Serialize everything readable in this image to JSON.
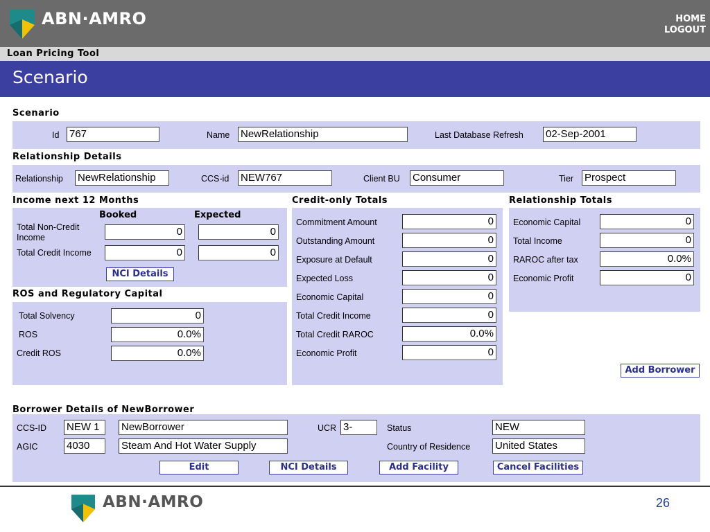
{
  "header": {
    "brand": "ABN·AMRO",
    "nav": {
      "home": "HOME",
      "logout": "LOGOUT"
    },
    "tool_name": "Loan Pricing Tool",
    "page_title": "Scenario"
  },
  "scenario": {
    "title": "Scenario",
    "id_label": "Id",
    "id_value": "767",
    "name_label": "Name",
    "name_value": "NewRelationship",
    "refresh_label": "Last Database Refresh",
    "refresh_value": "02-Sep-2001"
  },
  "relationship_details": {
    "title": "Relationship Details",
    "relationship_label": "Relationship",
    "relationship_value": "NewRelationship",
    "ccs_label": "CCS-id",
    "ccs_value": "NEW767",
    "bu_label": "Client BU",
    "bu_value": "Consumer",
    "tier_label": "Tier",
    "tier_value": "Prospect"
  },
  "income": {
    "title": "Income next 12 Months",
    "booked_header": "Booked",
    "expected_header": "Expected",
    "rows": [
      {
        "label": "Total Non-Credit Income",
        "booked": "0",
        "expected": "0"
      },
      {
        "label": "Total Credit Income",
        "booked": "0",
        "expected": "0"
      }
    ],
    "nci_button": "NCI Details"
  },
  "ros": {
    "title": "ROS and Regulatory Capital",
    "rows": [
      {
        "label": "Total Solvency",
        "value": "0"
      },
      {
        "label": "ROS",
        "value": "0.0%"
      },
      {
        "label": "Credit ROS",
        "value": "0.0%"
      }
    ]
  },
  "credit_totals": {
    "title": "Credit-only Totals",
    "rows": [
      {
        "label": "Commitment Amount",
        "value": "0"
      },
      {
        "label": "Outstanding Amount",
        "value": "0"
      },
      {
        "label": "Exposure at Default",
        "value": "0"
      },
      {
        "label": "Expected Loss",
        "value": "0"
      },
      {
        "label": "Economic Capital",
        "value": "0"
      },
      {
        "label": "Total Credit Income",
        "value": "0"
      },
      {
        "label": "Total Credit RAROC",
        "value": "0.0%"
      },
      {
        "label": "Economic Profit",
        "value": "0"
      }
    ]
  },
  "relationship_totals": {
    "title": "Relationship Totals",
    "rows": [
      {
        "label": "Economic Capital",
        "value": "0"
      },
      {
        "label": "Total Income",
        "value": "0"
      },
      {
        "label": "RAROC after tax",
        "value": "0.0%"
      },
      {
        "label": "Economic Profit",
        "value": "0"
      }
    ],
    "add_borrower_button": "Add Borrower"
  },
  "borrower": {
    "title": "Borrower Details of NewBorrower",
    "ccs_label": "CCS-ID",
    "ccs_value": "NEW 1",
    "name_value": "NewBorrower",
    "agic_label": "AGIC",
    "agic_value": "4030",
    "agic_desc": "Steam And Hot Water Supply",
    "ucr_label": "UCR",
    "ucr_value": "3-",
    "status_label": "Status",
    "status_value": "NEW",
    "country_label": "Country of Residence",
    "country_value": "United States",
    "buttons": {
      "edit": "Edit",
      "nci": "NCI Details",
      "add_facility": "Add Facility",
      "cancel": "Cancel Facilities"
    }
  },
  "footer": {
    "brand": "ABN·AMRO",
    "page_number": "26"
  },
  "colors": {
    "header_gray": "#6b6b6b",
    "title_blue": "#3b3fa0",
    "panel_lavender": "#cfd0f2",
    "logo_teal": "#1f8a8a",
    "logo_yellow": "#f2c200"
  },
  "icons": [
    "abn-amro-shield-icon"
  ]
}
